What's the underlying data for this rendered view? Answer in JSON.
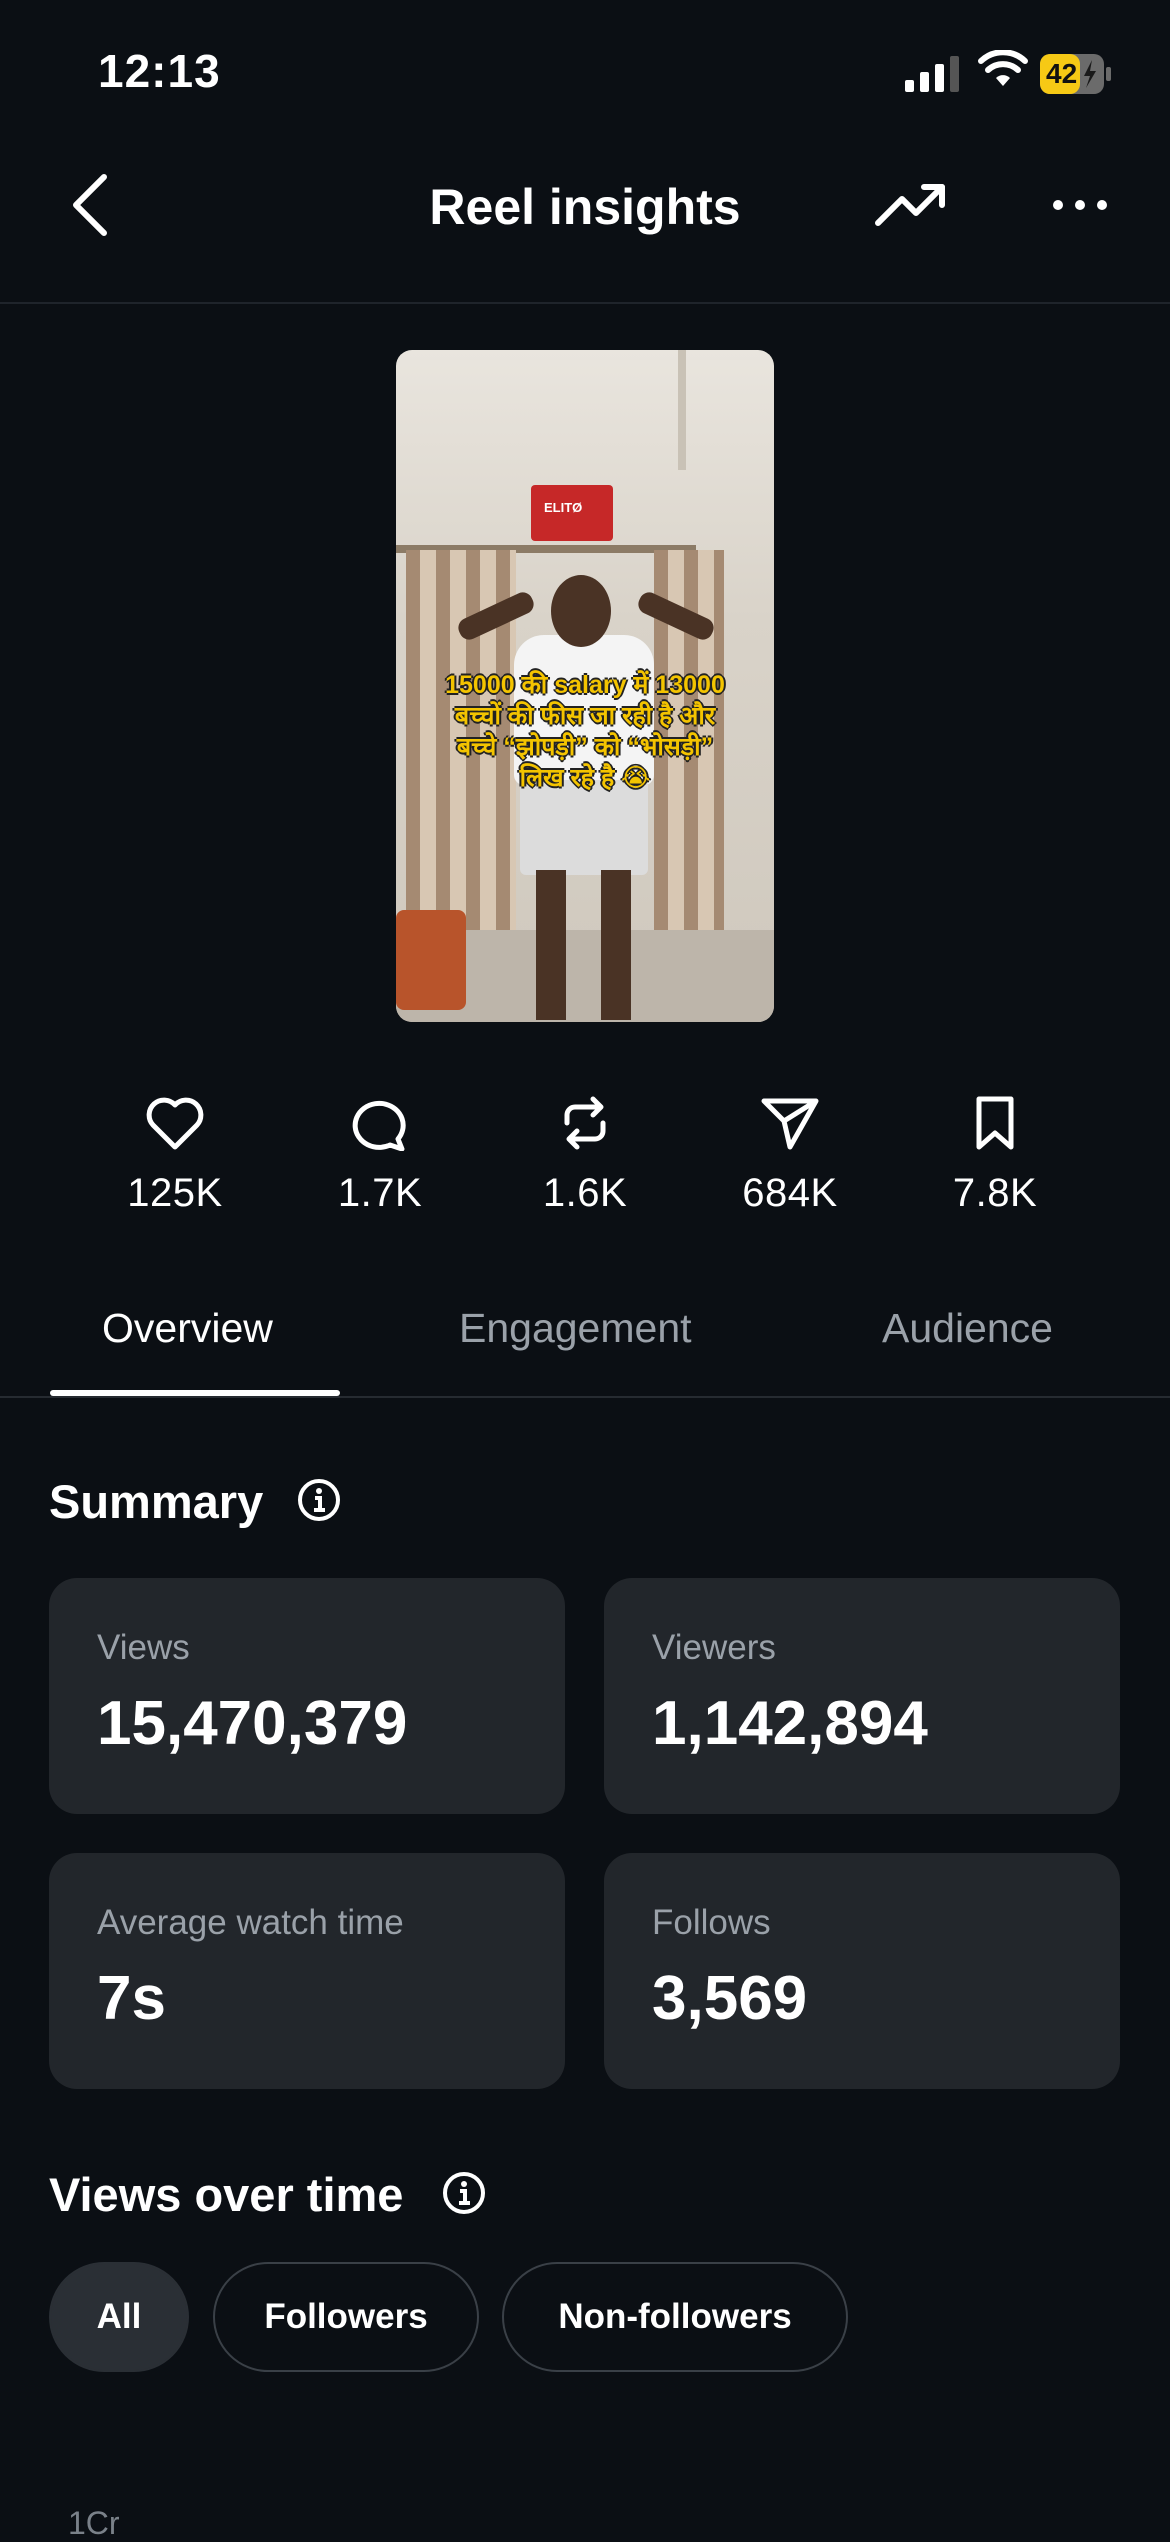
{
  "status_bar": {
    "time": "12:13",
    "battery": "42"
  },
  "header": {
    "title": "Reel insights"
  },
  "reel": {
    "caption": "15000 की salary में 13000 बच्चों की फीस जा रही है और बच्चे “झोपड़ी” को “भोसड़ी” लिख रहे है 😭",
    "sign_text": "ELITØ"
  },
  "stats": [
    {
      "icon": "heart-icon",
      "value": "125K"
    },
    {
      "icon": "comment-icon",
      "value": "1.7K"
    },
    {
      "icon": "repost-icon",
      "value": "1.6K"
    },
    {
      "icon": "share-icon",
      "value": "684K"
    },
    {
      "icon": "bookmark-icon",
      "value": "7.8K"
    }
  ],
  "tabs": [
    {
      "label": "Overview",
      "active": true
    },
    {
      "label": "Engagement",
      "active": false
    },
    {
      "label": "Audience",
      "active": false
    }
  ],
  "summary": {
    "title": "Summary",
    "cards": [
      {
        "label": "Views",
        "value": "15,470,379"
      },
      {
        "label": "Viewers",
        "value": "1,142,894"
      },
      {
        "label": "Average watch time",
        "value": "7s"
      },
      {
        "label": "Follows",
        "value": "3,569"
      }
    ]
  },
  "views_over_time": {
    "title": "Views over time",
    "filters": [
      {
        "label": "All",
        "selected": true
      },
      {
        "label": "Followers",
        "selected": false
      },
      {
        "label": "Non-followers",
        "selected": false
      }
    ],
    "axis_peek": "1Cr"
  },
  "colors": {
    "background": "#0b0f14",
    "card": "#22262b",
    "muted": "#9aa1a9",
    "accent": "#f4c400"
  }
}
